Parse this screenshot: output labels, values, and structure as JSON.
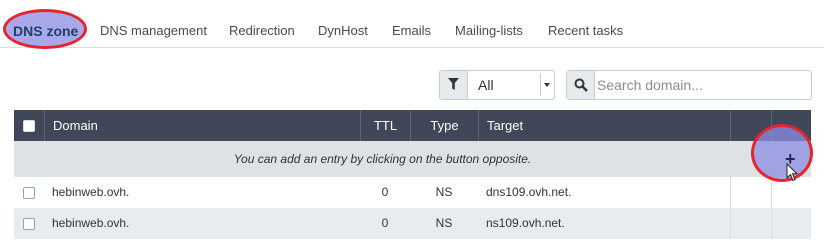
{
  "tabs": [
    {
      "label": "DNS zone",
      "active": true
    },
    {
      "label": "DNS management"
    },
    {
      "label": "Redirection"
    },
    {
      "label": "DynHost"
    },
    {
      "label": "Emails"
    },
    {
      "label": "Mailing-lists"
    },
    {
      "label": "Recent tasks"
    }
  ],
  "filter": {
    "selected": "All",
    "icon": "funnel-icon"
  },
  "search": {
    "placeholder": "Search domain...",
    "value": "",
    "icon": "search-icon"
  },
  "table": {
    "columns": [
      "Domain",
      "TTL",
      "Type",
      "Target"
    ],
    "info_text": "You can add an entry by clicking on the button opposite.",
    "rows": [
      {
        "domain": "hebinweb.ovh.",
        "ttl": "0",
        "type": "NS",
        "target": "dns109.ovh.net."
      },
      {
        "domain": "hebinweb.ovh.",
        "ttl": "0",
        "type": "NS",
        "target": "ns109.ovh.net."
      }
    ]
  },
  "add_button": {
    "label": "+",
    "icon": "plus-icon"
  },
  "colors": {
    "header_bg": "#3f4758",
    "highlight": "#e6242c",
    "active_tab_text": "#1f3f6a"
  }
}
